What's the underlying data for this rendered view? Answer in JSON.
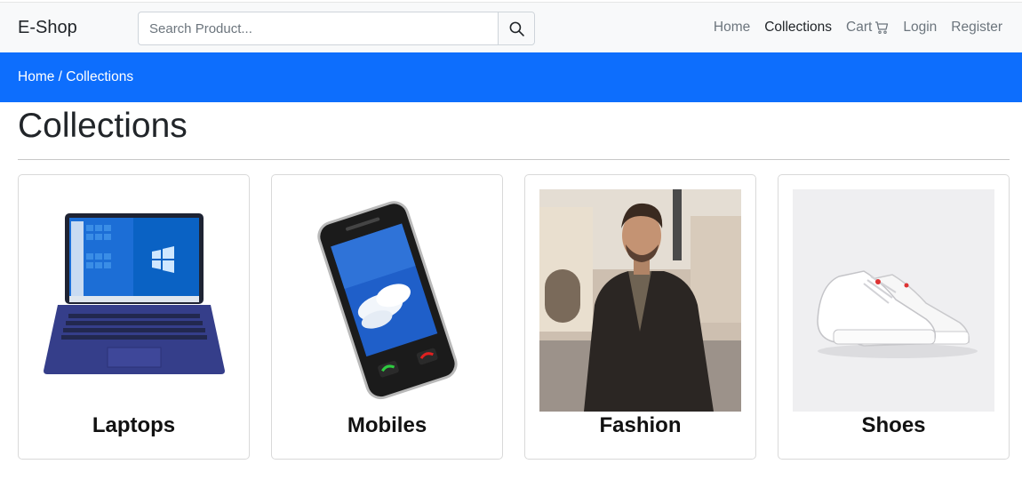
{
  "navbar": {
    "brand": "E-Shop",
    "search_placeholder": "Search Product...",
    "links": [
      "Home",
      "Collections",
      "Cart",
      "Login",
      "Register"
    ],
    "active_link": "Collections"
  },
  "breadcrumb": "Home / Collections",
  "page_title": "Collections",
  "collections": [
    {
      "label": "Laptops"
    },
    {
      "label": "Mobiles"
    },
    {
      "label": "Fashion"
    },
    {
      "label": "Shoes"
    }
  ],
  "colors": {
    "accent": "#0d6efd",
    "navbar_bg": "#f8f9fa",
    "muted_text": "#6c757d"
  },
  "icons": [
    "search-icon",
    "cart-icon"
  ]
}
